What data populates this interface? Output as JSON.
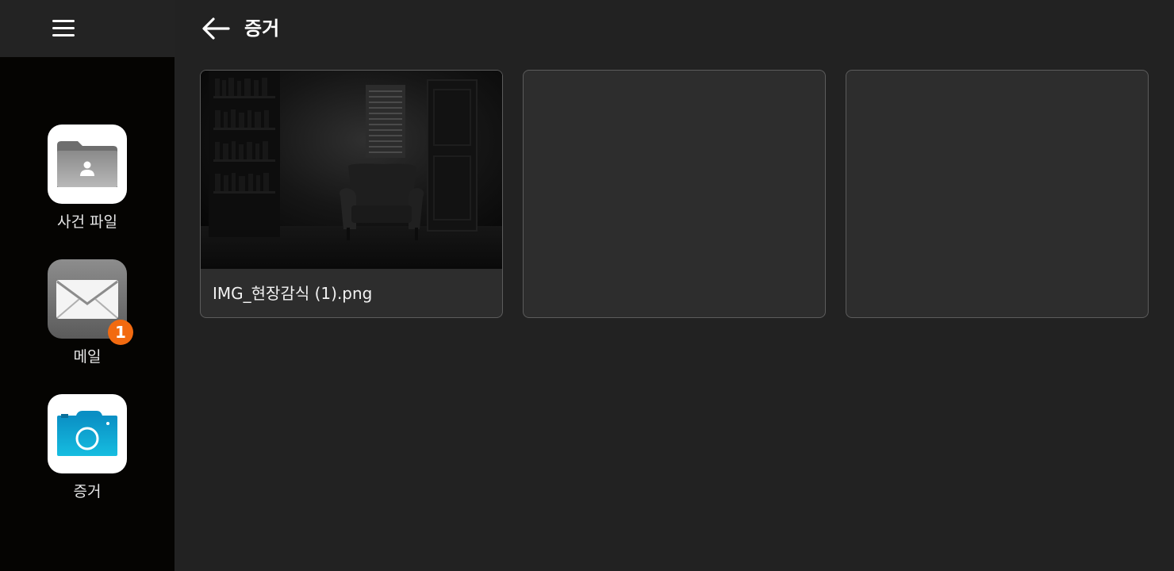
{
  "sidebar": {
    "apps": [
      {
        "label": "사건 파일",
        "icon": "folder-person-icon"
      },
      {
        "label": "메일",
        "icon": "envelope-icon",
        "badge": "1"
      },
      {
        "label": "증거",
        "icon": "camera-icon"
      }
    ]
  },
  "header": {
    "title": "증거"
  },
  "evidence": {
    "items": [
      {
        "caption": "IMG_현장감식 (1).png",
        "thumbnail": "dark-room-armchair-photo"
      }
    ]
  },
  "colors": {
    "sidebar_bg": "#050402",
    "content_bg": "#222222",
    "card_bg": "#2d2d2d",
    "badge": "#f26a10",
    "camera_accent": "#14b4d8"
  }
}
